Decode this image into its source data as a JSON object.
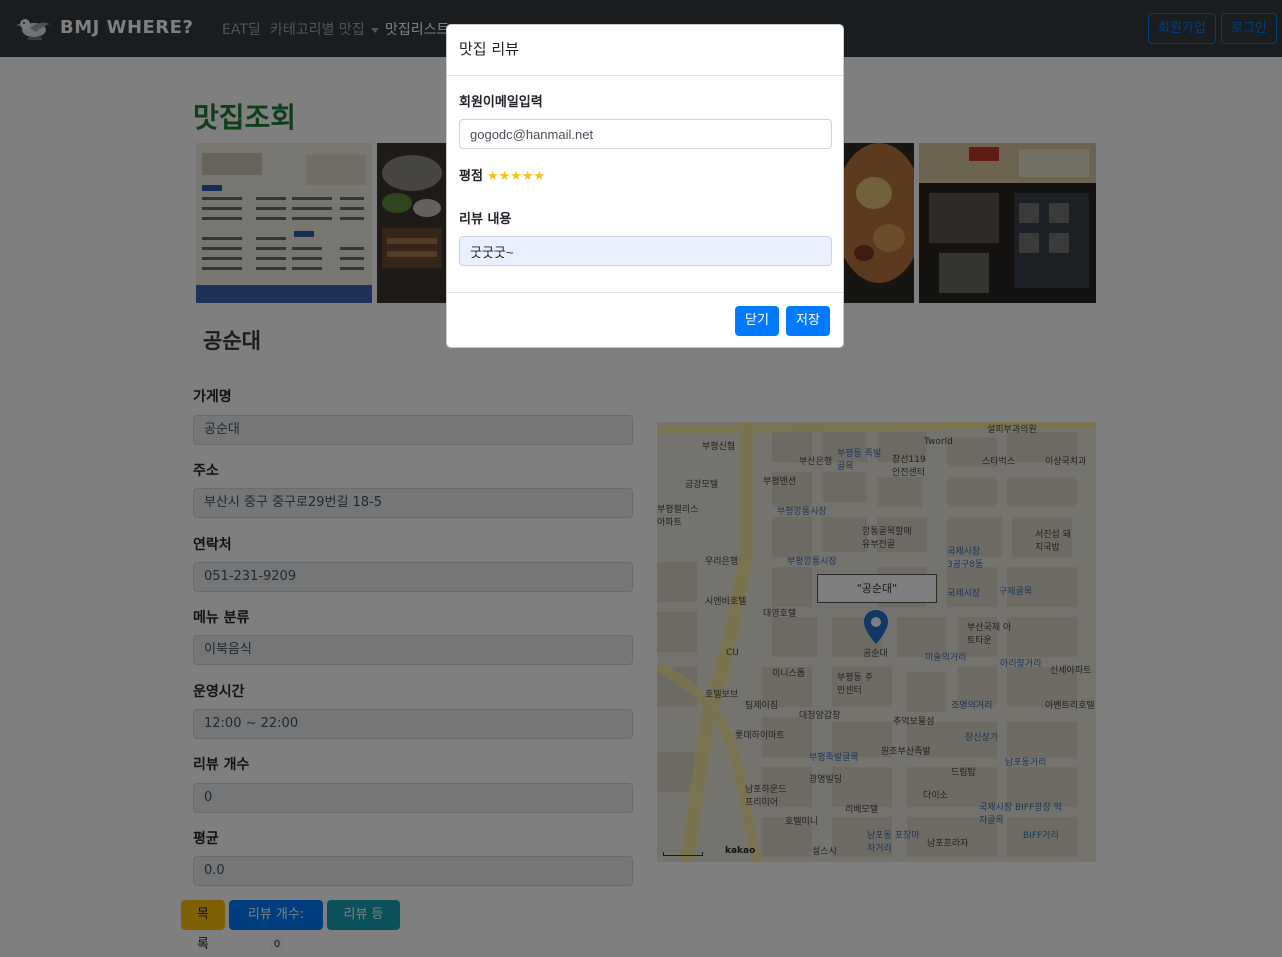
{
  "navbar": {
    "brand": "BMJ WHERE?",
    "links": [
      "EAT딜",
      "카테고리별 맛집",
      "맛집리스트"
    ],
    "signup": "회원가입",
    "login": "로그인"
  },
  "page": {
    "title": "맛집조회",
    "store_heading": "공순대"
  },
  "fields": [
    {
      "label": "가게명",
      "value": "공순대"
    },
    {
      "label": "주소",
      "value": "부산시 중구 중구로29번길 18-5"
    },
    {
      "label": "연락처",
      "value": "051-231-9209"
    },
    {
      "label": "메뉴 분류",
      "value": "이북음식"
    },
    {
      "label": "운영시간",
      "value": "12:00 ~ 22:00"
    },
    {
      "label": "리뷰 개수",
      "value": "0"
    },
    {
      "label": "평균",
      "value": "0.0"
    }
  ],
  "buttons": {
    "list": "목록",
    "review_count_label": "리뷰 개수:",
    "review_count": "0",
    "review_register": "리뷰 등록"
  },
  "map": {
    "place_label": "\"공순대\"",
    "marker_label": "공순대",
    "labels": [
      "부평신협",
      "부산은행",
      "부평동 족발골목",
      "창선119 안전센터",
      "Tworld",
      "설피부과의원",
      "스타벅스",
      "이상국치과",
      "금강모텔",
      "부평맨션",
      "부평펠리스 아파트",
      "부평깡통시장",
      "깡통골목할매 유부전골",
      "부평깡통시장",
      "우리은행",
      "국제시장 3공구8동",
      "서진섭 돼지국밥",
      "국제시장",
      "구제골목",
      "시엔비호텔",
      "대영호텔",
      "부산국제 아트타운",
      "미술의거리",
      "CU",
      "미니스톱",
      "부평동 주민센터",
      "아리랑거리",
      "신세아파트",
      "호텔보브",
      "팀제이짐",
      "대청양갑창",
      "조명의거리",
      "추억보물섬",
      "아벤트리호텔",
      "롯데하이마트",
      "장신상가",
      "원조부산족발",
      "부평족발골목",
      "광명빌딩",
      "드림탑",
      "남포동거리",
      "남포하운드 프리미어",
      "다이소",
      "리베모텔",
      "호텔미니",
      "국제시장 BIFF광장 먹자골목",
      "남포동 포장마차거리",
      "남포프라자",
      "BIFF거리",
      "설스시",
      "Kakao"
    ],
    "attribution": "kakao"
  },
  "modal": {
    "title": "맛집 리뷰",
    "email_label": "회원이메일입력",
    "email_value": "gogodc@hanmail.net",
    "rating_label": "평점",
    "rating_stars": "★★★★★",
    "rating_value": 5,
    "content_label": "리뷰 내용",
    "content_value": "굿굿굿~",
    "close_button": "닫기",
    "save_button": "저장"
  },
  "colors": {
    "navbar_bg": "#343a40",
    "primary": "#007bff",
    "title_green": "#1e7e34",
    "warning": "#ffc107",
    "info": "#17a2b8",
    "star": "#ffc107"
  }
}
